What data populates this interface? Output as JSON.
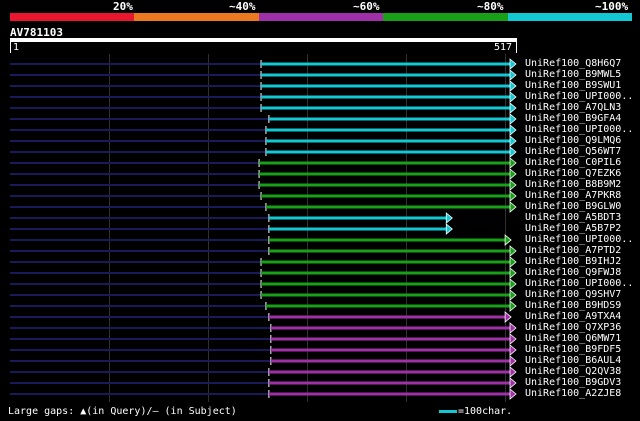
{
  "legend": {
    "colors": [
      "#e8162e",
      "#ec7820",
      "#a030a8",
      "#18a018",
      "#12c8d2"
    ],
    "labels": [
      "20%",
      "~40%",
      "~60%",
      "~80%",
      "~100%"
    ]
  },
  "query": {
    "name": "AV781103",
    "start": "1",
    "end": "517",
    "length": 517
  },
  "hits": [
    {
      "label": "UniRef100_Q8H6Q7",
      "color": "#12c8d2",
      "start": 257,
      "end": 517,
      "arrow": true
    },
    {
      "label": "UniRef100_B9MWL5",
      "color": "#12c8d2",
      "start": 257,
      "end": 517,
      "arrow": true
    },
    {
      "label": "UniRef100_B9SWU1",
      "color": "#12c8d2",
      "start": 257,
      "end": 517,
      "arrow": true
    },
    {
      "label": "UniRef100_UPI000..",
      "color": "#12c8d2",
      "start": 257,
      "end": 517,
      "arrow": true
    },
    {
      "label": "UniRef100_A7QLN3",
      "color": "#12c8d2",
      "start": 257,
      "end": 517,
      "arrow": true
    },
    {
      "label": "UniRef100_B9GFA4",
      "color": "#12c8d2",
      "start": 265,
      "end": 517,
      "arrow": true
    },
    {
      "label": "UniRef100_UPI000..",
      "color": "#12c8d2",
      "start": 262,
      "end": 517,
      "arrow": true
    },
    {
      "label": "UniRef100_Q9LMQ6",
      "color": "#12c8d2",
      "start": 262,
      "end": 517,
      "arrow": true
    },
    {
      "label": "UniRef100_Q56WT7",
      "color": "#12c8d2",
      "start": 262,
      "end": 517,
      "arrow": true
    },
    {
      "label": "UniRef100_C0PIL6",
      "color": "#18a018",
      "start": 255,
      "end": 517,
      "arrow": true
    },
    {
      "label": "UniRef100_Q7EZK6",
      "color": "#18a018",
      "start": 255,
      "end": 517,
      "arrow": true
    },
    {
      "label": "UniRef100_B8B9M2",
      "color": "#18a018",
      "start": 255,
      "end": 517,
      "arrow": true
    },
    {
      "label": "UniRef100_A7PKR8",
      "color": "#18a018",
      "start": 257,
      "end": 517,
      "arrow": true
    },
    {
      "label": "UniRef100_B9GLW0",
      "color": "#18a018",
      "start": 262,
      "end": 517,
      "arrow": true
    },
    {
      "label": "UniRef100_A5BDT3",
      "color": "#12c8d2",
      "start": 265,
      "end": 452,
      "arrow": true
    },
    {
      "label": "UniRef100_A5B7P2",
      "color": "#12c8d2",
      "start": 265,
      "end": 452,
      "arrow": true
    },
    {
      "label": "UniRef100_UPI000..",
      "color": "#18a018",
      "start": 265,
      "end": 512,
      "arrow": true
    },
    {
      "label": "UniRef100_A7PTD2",
      "color": "#18a018",
      "start": 265,
      "end": 517,
      "arrow": true
    },
    {
      "label": "UniRef100_B9IHJ2",
      "color": "#18a018",
      "start": 257,
      "end": 517,
      "arrow": true
    },
    {
      "label": "UniRef100_Q9FWJ8",
      "color": "#18a018",
      "start": 257,
      "end": 517,
      "arrow": true
    },
    {
      "label": "UniRef100_UPI000..",
      "color": "#18a018",
      "start": 257,
      "end": 517,
      "arrow": true
    },
    {
      "label": "UniRef100_Q9SHV7",
      "color": "#18a018",
      "start": 257,
      "end": 517,
      "arrow": true
    },
    {
      "label": "UniRef100_B9HDS9",
      "color": "#18a018",
      "start": 262,
      "end": 517,
      "arrow": true
    },
    {
      "label": "UniRef100_A9TXA4",
      "color": "#a030a8",
      "start": 265,
      "end": 512,
      "arrow": true
    },
    {
      "label": "UniRef100_Q7XP36",
      "color": "#a030a8",
      "start": 267,
      "end": 517,
      "arrow": true
    },
    {
      "label": "UniRef100_Q6MW71",
      "color": "#a030a8",
      "start": 267,
      "end": 517,
      "arrow": true
    },
    {
      "label": "UniRef100_B9FDF5",
      "color": "#a030a8",
      "start": 267,
      "end": 517,
      "arrow": true
    },
    {
      "label": "UniRef100_B6AUL4",
      "color": "#a030a8",
      "start": 267,
      "end": 517,
      "arrow": true
    },
    {
      "label": "UniRef100_Q2QV38",
      "color": "#a030a8",
      "start": 265,
      "end": 517,
      "arrow": true
    },
    {
      "label": "UniRef100_B9GDV3",
      "color": "#a030a8",
      "start": 265,
      "end": 517,
      "arrow": true
    },
    {
      "label": "UniRef100_A2ZJE8",
      "color": "#a030a8",
      "start": 265,
      "end": 517,
      "arrow": true
    }
  ],
  "footer": {
    "gaps_text": "Large gaps: ▲(in Query)/– (in Subject)",
    "scale_text": "=100char."
  }
}
